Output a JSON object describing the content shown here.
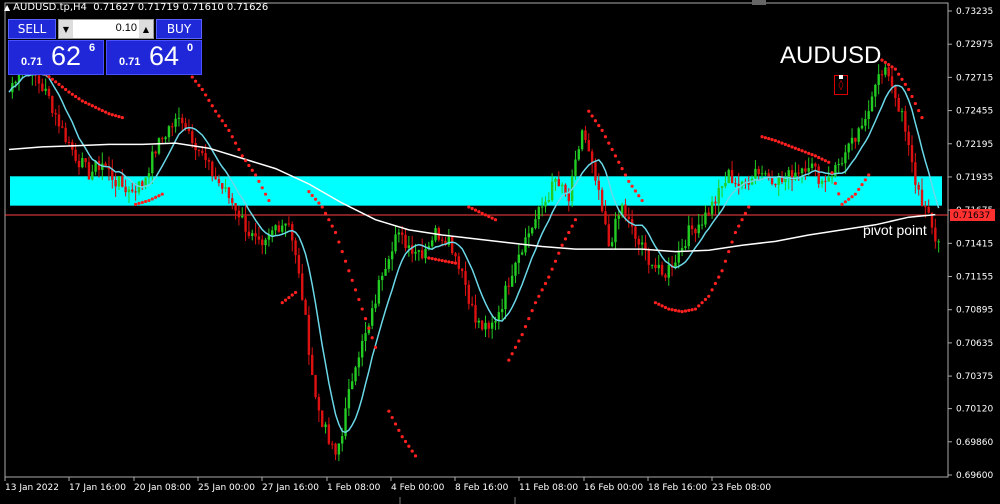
{
  "header": {
    "symbol_timeframe": "AUDUSD.tp,H4",
    "ohlc": "0.71627 0.71719 0.71610 0.71626"
  },
  "trade_panel": {
    "sell_label": "SELL",
    "buy_label": "BUY",
    "lot": "0.10",
    "sell_price": {
      "prefix": "0.71",
      "big": "62",
      "sup": "6"
    },
    "buy_price": {
      "prefix": "0.71",
      "big": "64",
      "sup": "0"
    }
  },
  "symbol_label": "AUDUSD",
  "pivot_label": "pivot point",
  "current_price_label": "0.71637",
  "colors": {
    "background": "#000000",
    "zone": "#00ffff",
    "pivot_line": "#ff4040",
    "ma_fast": "#6ad8e8",
    "ma_slow": "#ffffff",
    "sar": "#ff2020",
    "bull": "#22cc22",
    "bear": "#dd1111",
    "accent": "#2029d8"
  },
  "chart_data": {
    "type": "candlestick",
    "title": "AUDUSD",
    "y_ticks": [
      "0.73235",
      "0.72975",
      "0.72715",
      "0.72455",
      "0.72195",
      "0.71935",
      "0.71675",
      "0.71415",
      "0.71155",
      "0.70895",
      "0.70635",
      "0.70375",
      "0.70120",
      "0.69860",
      "0.69600"
    ],
    "ylim": [
      0.696,
      0.73235
    ],
    "x_ticks": [
      "13 Jan 2022",
      "17 Jan 16:00",
      "20 Jan 08:00",
      "25 Jan 00:00",
      "27 Jan 16:00",
      "1 Feb 08:00",
      "4 Feb 00:00",
      "8 Feb 16:00",
      "11 Feb 08:00",
      "16 Feb 00:00",
      "18 Feb 16:00",
      "23 Feb 08:00"
    ],
    "resistance_zone": [
      0.7171,
      0.7194
    ],
    "pivot_level": 0.71637,
    "current_price": 0.71637,
    "close_path": [
      [
        0,
        0.726
      ],
      [
        4,
        0.7285
      ],
      [
        8,
        0.7272
      ],
      [
        12,
        0.7255
      ],
      [
        16,
        0.723
      ],
      [
        20,
        0.721
      ],
      [
        24,
        0.7196
      ],
      [
        28,
        0.7205
      ],
      [
        32,
        0.719
      ],
      [
        36,
        0.7183
      ],
      [
        40,
        0.7188
      ],
      [
        44,
        0.7215
      ],
      [
        48,
        0.7232
      ],
      [
        52,
        0.724
      ],
      [
        56,
        0.722
      ],
      [
        60,
        0.72
      ],
      [
        64,
        0.7185
      ],
      [
        68,
        0.717
      ],
      [
        72,
        0.715
      ],
      [
        76,
        0.7135
      ],
      [
        80,
        0.7155
      ],
      [
        84,
        0.716
      ],
      [
        88,
        0.71
      ],
      [
        92,
        0.702
      ],
      [
        96,
        0.6985
      ],
      [
        98,
        0.6975
      ],
      [
        100,
        0.6995
      ],
      [
        104,
        0.705
      ],
      [
        108,
        0.7075
      ],
      [
        112,
        0.712
      ],
      [
        116,
        0.7148
      ],
      [
        120,
        0.714
      ],
      [
        124,
        0.7135
      ],
      [
        128,
        0.715
      ],
      [
        132,
        0.7145
      ],
      [
        136,
        0.712
      ],
      [
        140,
        0.708
      ],
      [
        144,
        0.7072
      ],
      [
        148,
        0.7095
      ],
      [
        152,
        0.713
      ],
      [
        156,
        0.715
      ],
      [
        160,
        0.717
      ],
      [
        164,
        0.719
      ],
      [
        168,
        0.7175
      ],
      [
        172,
        0.723
      ],
      [
        174,
        0.721
      ],
      [
        176,
        0.719
      ],
      [
        180,
        0.714
      ],
      [
        184,
        0.717
      ],
      [
        188,
        0.7145
      ],
      [
        192,
        0.713
      ],
      [
        196,
        0.7115
      ],
      [
        200,
        0.713
      ],
      [
        204,
        0.715
      ],
      [
        208,
        0.716
      ],
      [
        212,
        0.7175
      ],
      [
        216,
        0.7195
      ],
      [
        220,
        0.7185
      ],
      [
        224,
        0.72
      ],
      [
        228,
        0.7195
      ],
      [
        232,
        0.719
      ],
      [
        236,
        0.7198
      ],
      [
        240,
        0.7205
      ],
      [
        244,
        0.719
      ],
      [
        248,
        0.72
      ],
      [
        252,
        0.7215
      ],
      [
        256,
        0.723
      ],
      [
        260,
        0.727
      ],
      [
        264,
        0.7275
      ],
      [
        268,
        0.724
      ],
      [
        272,
        0.719
      ],
      [
        276,
        0.716
      ],
      [
        278,
        0.7145
      ]
    ],
    "sma_slow": [
      [
        0,
        0.7215
      ],
      [
        10,
        0.7217
      ],
      [
        20,
        0.7218
      ],
      [
        30,
        0.7219
      ],
      [
        40,
        0.7219
      ],
      [
        50,
        0.722
      ],
      [
        60,
        0.7216
      ],
      [
        70,
        0.7208
      ],
      [
        80,
        0.72
      ],
      [
        90,
        0.7188
      ],
      [
        100,
        0.7173
      ],
      [
        110,
        0.716
      ],
      [
        120,
        0.7152
      ],
      [
        130,
        0.7148
      ],
      [
        140,
        0.7145
      ],
      [
        150,
        0.7142
      ],
      [
        160,
        0.7139
      ],
      [
        170,
        0.7137
      ],
      [
        180,
        0.7137
      ],
      [
        190,
        0.7137
      ],
      [
        200,
        0.7135
      ],
      [
        210,
        0.7136
      ],
      [
        220,
        0.714
      ],
      [
        230,
        0.7143
      ],
      [
        240,
        0.7148
      ],
      [
        250,
        0.7152
      ],
      [
        260,
        0.7156
      ],
      [
        270,
        0.7162
      ],
      [
        278,
        0.7164
      ]
    ],
    "sar_points": [
      [
        2,
        0.7285
      ],
      [
        6,
        0.7283
      ],
      [
        10,
        0.7276
      ],
      [
        14,
        0.7268
      ],
      [
        18,
        0.726
      ],
      [
        22,
        0.7253
      ],
      [
        26,
        0.7248
      ],
      [
        30,
        0.7243
      ],
      [
        34,
        0.724
      ],
      [
        38,
        0.7172
      ],
      [
        42,
        0.7175
      ],
      [
        46,
        0.718
      ],
      [
        50,
        0.7285
      ],
      [
        54,
        0.7275
      ],
      [
        58,
        0.7262
      ],
      [
        62,
        0.7245
      ],
      [
        66,
        0.723
      ],
      [
        70,
        0.721
      ],
      [
        74,
        0.7195
      ],
      [
        78,
        0.7175
      ],
      [
        82,
        0.7095
      ],
      [
        86,
        0.7103
      ],
      [
        90,
        0.7182
      ],
      [
        94,
        0.717
      ],
      [
        98,
        0.715
      ],
      [
        102,
        0.712
      ],
      [
        106,
        0.709
      ],
      [
        110,
        0.706
      ],
      [
        114,
        0.701
      ],
      [
        118,
        0.699
      ],
      [
        122,
        0.6975
      ],
      [
        126,
        0.713
      ],
      [
        130,
        0.7128
      ],
      [
        134,
        0.7126
      ],
      [
        138,
        0.717
      ],
      [
        142,
        0.7165
      ],
      [
        146,
        0.716
      ],
      [
        150,
        0.705
      ],
      [
        154,
        0.707
      ],
      [
        158,
        0.7095
      ],
      [
        162,
        0.7115
      ],
      [
        166,
        0.714
      ],
      [
        170,
        0.716
      ],
      [
        174,
        0.7245
      ],
      [
        178,
        0.723
      ],
      [
        182,
        0.721
      ],
      [
        186,
        0.719
      ],
      [
        190,
        0.7175
      ],
      [
        194,
        0.7095
      ],
      [
        198,
        0.709
      ],
      [
        202,
        0.7088
      ],
      [
        206,
        0.709
      ],
      [
        210,
        0.71
      ],
      [
        214,
        0.712
      ],
      [
        218,
        0.715
      ],
      [
        222,
        0.717
      ],
      [
        226,
        0.7225
      ],
      [
        230,
        0.7222
      ],
      [
        234,
        0.7218
      ],
      [
        238,
        0.7214
      ],
      [
        242,
        0.721
      ],
      [
        246,
        0.7205
      ],
      [
        250,
        0.7172
      ],
      [
        254,
        0.718
      ],
      [
        258,
        0.7195
      ],
      [
        262,
        0.7285
      ],
      [
        266,
        0.7278
      ],
      [
        270,
        0.7262
      ],
      [
        274,
        0.724
      ]
    ]
  }
}
